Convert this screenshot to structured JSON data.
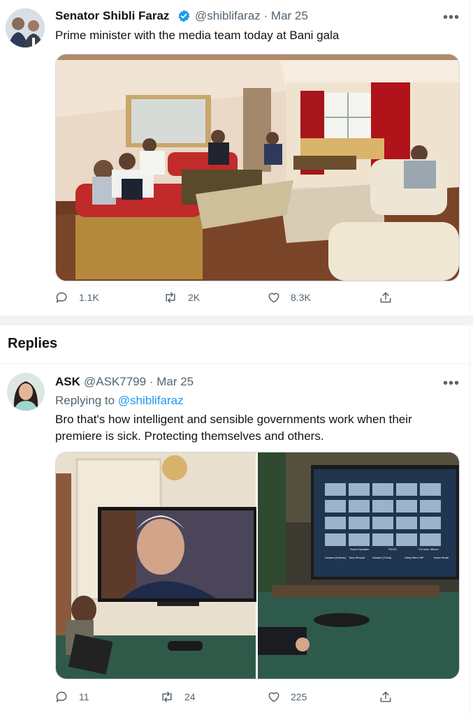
{
  "tweet": {
    "author_name": "Senator Shibli Faraz",
    "handle": "@shiblifaraz",
    "date": "· Mar 25",
    "text": "Prime minister with the media team today at Bani gala",
    "more_label": "•••",
    "actions": {
      "replies": "1.1K",
      "retweets": "2K",
      "likes": "8.3K"
    }
  },
  "section_title": "Replies",
  "reply": {
    "author_name": "ASK",
    "handle": "@ASK7799",
    "date": "· Mar 25",
    "replying_label": "Replying to",
    "replying_to": "@shiblifaraz",
    "text": "Bro that's how intelligent and  sensible governments work when their premiere is sick. Protecting themselves and others.",
    "more_label": "•••",
    "actions": {
      "replies": "11",
      "retweets": "24",
      "likes": "225"
    },
    "screen_tiles": [
      "Sound Speaker",
      "TSO32",
      "Co Host, Wilson",
      "Howard (Dolaris)",
      "Toby Stewart",
      "Howard (Tricia)",
      "Hilary Benn MP",
      "Karen Bradl"
    ]
  },
  "colors": {
    "accent": "#1d9bf0",
    "verified": "#1d9bf0",
    "muted": "#536471"
  }
}
